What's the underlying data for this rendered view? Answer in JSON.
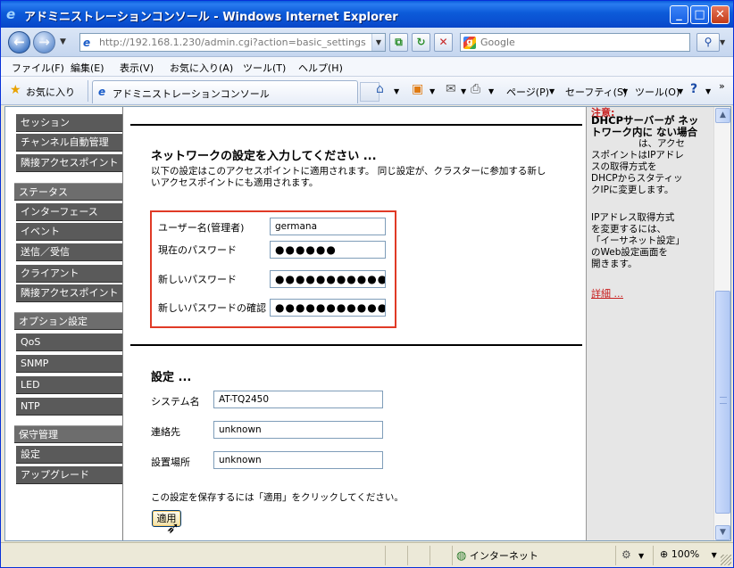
{
  "window": {
    "title": "アドミニストレーションコンソール - Windows Internet Explorer"
  },
  "address": {
    "url": "http://192.168.1.230/admin.cgi?action=basic_settings",
    "search_placeholder": "Google"
  },
  "menubar": {
    "items": [
      "ファイル(F)",
      "編集(E)",
      "表示(V)",
      "お気に入り(A)",
      "ツール(T)",
      "ヘルプ(H)"
    ]
  },
  "cmdbar": {
    "favorites": "お気に入り",
    "tab_title": "アドミニストレーションコンソール",
    "page": "ページ(P)",
    "safety": "セーフティ(S)",
    "tools": "ツール(O)"
  },
  "leftnav": {
    "items": [
      {
        "label": "セッション"
      },
      {
        "label": "チャンネル自動管理"
      },
      {
        "label": "隣接アクセスポイント"
      },
      {
        "label": "ステータス"
      },
      {
        "label": "インターフェース"
      },
      {
        "label": "イベント"
      },
      {
        "label": "送信／受信"
      },
      {
        "label": "クライアント"
      },
      {
        "label": "隣接アクセスポイント"
      },
      {
        "label": "オプション設定"
      },
      {
        "label": "QoS"
      },
      {
        "label": "SNMP"
      },
      {
        "label": "LED"
      },
      {
        "label": "NTP"
      },
      {
        "label": "保守管理"
      },
      {
        "label": "設定"
      },
      {
        "label": "アップグレード"
      }
    ]
  },
  "network": {
    "title": "ネットワークの設定を入力してください ...",
    "desc_line1": "以下の設定はこのアクセスポイントに適用されます。 同じ設定が、クラスターに参加する新し",
    "desc_line2": "いアクセスポイントにも適用されます。",
    "username_label": "ユーザー名(管理者)",
    "username_value": "germana",
    "current_pw_label": "現在のパスワード",
    "current_pw_value": "●●●●●●",
    "new_pw_label": "新しいパスワード",
    "new_pw_value": "●●●●●●●●●●●●●",
    "confirm_pw_label": "新しいパスワードの確認",
    "confirm_pw_value": "●●●●●●●●●●●●●"
  },
  "settings": {
    "title": "設定 ...",
    "system_name_label": "システム名",
    "system_name_value": "AT-TQ2450",
    "contact_label": "連絡先",
    "contact_value": "unknown",
    "location_label": "設置場所",
    "location_value": "unknown",
    "save_note": "この設定を保存するには「適用」をクリックしてください。",
    "apply_label": "適用"
  },
  "help": {
    "warning": "注意:",
    "bold_text": "DHCPサーバーが ネットワーク内に ない場合",
    "text1_a": "は、アクセ",
    "text1_b": "スポイントはIPアドレ",
    "text1_c": "スの取得方式を",
    "text1_d": "DHCPからスタティッ",
    "text1_e": "クIPに変更します。",
    "text2_a": "IPアドレス取得方式",
    "text2_b": "を変更するには、",
    "text2_c": "「イーサネット設定」",
    "text2_d": "のWeb設定画面を",
    "text2_e": "開きます。",
    "link": "詳細 ..."
  },
  "statusbar": {
    "zone": "インターネット",
    "zoom": "100%"
  }
}
